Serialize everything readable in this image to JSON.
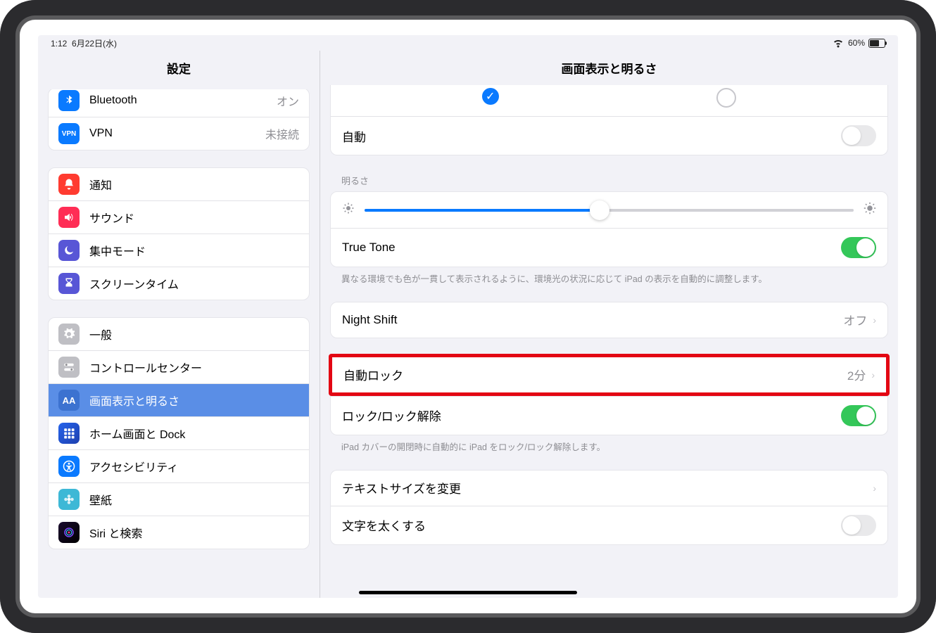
{
  "status": {
    "time": "1:12",
    "date": "6月22日(水)",
    "battery": "60%"
  },
  "sidebar": {
    "title": "設定",
    "rows": {
      "bluetooth": {
        "label": "Bluetooth",
        "value": "オン"
      },
      "vpn": {
        "label": "VPN",
        "value": "未接続"
      },
      "notifications": "通知",
      "sounds": "サウンド",
      "focus": "集中モード",
      "screentime": "スクリーンタイム",
      "general": "一般",
      "controlcenter": "コントロールセンター",
      "display": "画面表示と明るさ",
      "home": "ホーム画面と Dock",
      "accessibility": "アクセシビリティ",
      "wallpaper": "壁紙",
      "siri": "Siri と検索"
    }
  },
  "detail": {
    "title": "画面表示と明るさ",
    "auto": "自動",
    "brightness_header": "明るさ",
    "truetone": "True Tone",
    "truetone_footer": "異なる環境でも色が一貫して表示されるように、環境光の状況に応じて iPad の表示を自動的に調整します。",
    "nightshift": {
      "label": "Night Shift",
      "value": "オフ"
    },
    "autolock": {
      "label": "自動ロック",
      "value": "2分"
    },
    "lockunlock": "ロック/ロック解除",
    "lockunlock_footer": "iPad カバーの開閉時に自動的に iPad をロック/ロック解除します。",
    "textsize": "テキストサイズを変更",
    "boldtext": "文字を太くする"
  }
}
